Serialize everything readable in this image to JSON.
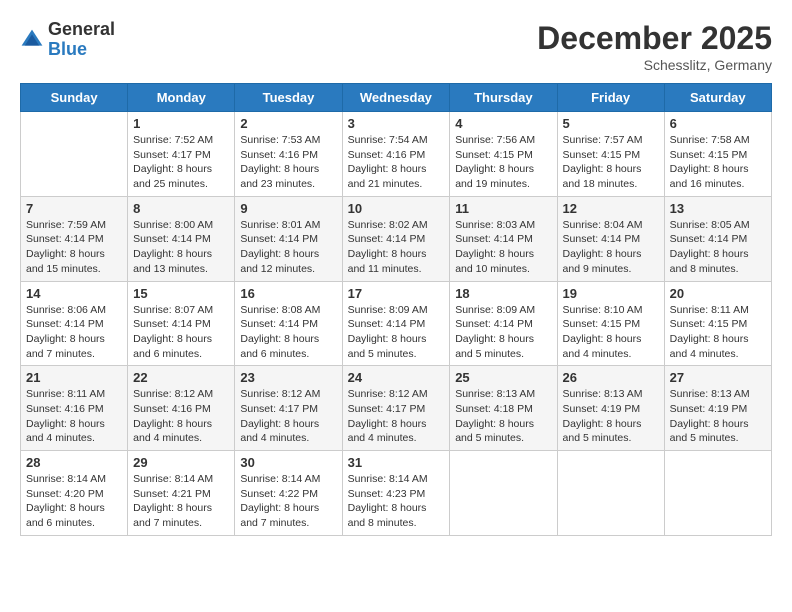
{
  "header": {
    "logo_general": "General",
    "logo_blue": "Blue",
    "month_title": "December 2025",
    "location": "Schesslitz, Germany"
  },
  "days_of_week": [
    "Sunday",
    "Monday",
    "Tuesday",
    "Wednesday",
    "Thursday",
    "Friday",
    "Saturday"
  ],
  "weeks": [
    [
      {
        "day": "",
        "content": ""
      },
      {
        "day": "1",
        "content": "Sunrise: 7:52 AM\nSunset: 4:17 PM\nDaylight: 8 hours\nand 25 minutes."
      },
      {
        "day": "2",
        "content": "Sunrise: 7:53 AM\nSunset: 4:16 PM\nDaylight: 8 hours\nand 23 minutes."
      },
      {
        "day": "3",
        "content": "Sunrise: 7:54 AM\nSunset: 4:16 PM\nDaylight: 8 hours\nand 21 minutes."
      },
      {
        "day": "4",
        "content": "Sunrise: 7:56 AM\nSunset: 4:15 PM\nDaylight: 8 hours\nand 19 minutes."
      },
      {
        "day": "5",
        "content": "Sunrise: 7:57 AM\nSunset: 4:15 PM\nDaylight: 8 hours\nand 18 minutes."
      },
      {
        "day": "6",
        "content": "Sunrise: 7:58 AM\nSunset: 4:15 PM\nDaylight: 8 hours\nand 16 minutes."
      }
    ],
    [
      {
        "day": "7",
        "content": "Sunrise: 7:59 AM\nSunset: 4:14 PM\nDaylight: 8 hours\nand 15 minutes."
      },
      {
        "day": "8",
        "content": "Sunrise: 8:00 AM\nSunset: 4:14 PM\nDaylight: 8 hours\nand 13 minutes."
      },
      {
        "day": "9",
        "content": "Sunrise: 8:01 AM\nSunset: 4:14 PM\nDaylight: 8 hours\nand 12 minutes."
      },
      {
        "day": "10",
        "content": "Sunrise: 8:02 AM\nSunset: 4:14 PM\nDaylight: 8 hours\nand 11 minutes."
      },
      {
        "day": "11",
        "content": "Sunrise: 8:03 AM\nSunset: 4:14 PM\nDaylight: 8 hours\nand 10 minutes."
      },
      {
        "day": "12",
        "content": "Sunrise: 8:04 AM\nSunset: 4:14 PM\nDaylight: 8 hours\nand 9 minutes."
      },
      {
        "day": "13",
        "content": "Sunrise: 8:05 AM\nSunset: 4:14 PM\nDaylight: 8 hours\nand 8 minutes."
      }
    ],
    [
      {
        "day": "14",
        "content": "Sunrise: 8:06 AM\nSunset: 4:14 PM\nDaylight: 8 hours\nand 7 minutes."
      },
      {
        "day": "15",
        "content": "Sunrise: 8:07 AM\nSunset: 4:14 PM\nDaylight: 8 hours\nand 6 minutes."
      },
      {
        "day": "16",
        "content": "Sunrise: 8:08 AM\nSunset: 4:14 PM\nDaylight: 8 hours\nand 6 minutes."
      },
      {
        "day": "17",
        "content": "Sunrise: 8:09 AM\nSunset: 4:14 PM\nDaylight: 8 hours\nand 5 minutes."
      },
      {
        "day": "18",
        "content": "Sunrise: 8:09 AM\nSunset: 4:14 PM\nDaylight: 8 hours\nand 5 minutes."
      },
      {
        "day": "19",
        "content": "Sunrise: 8:10 AM\nSunset: 4:15 PM\nDaylight: 8 hours\nand 4 minutes."
      },
      {
        "day": "20",
        "content": "Sunrise: 8:11 AM\nSunset: 4:15 PM\nDaylight: 8 hours\nand 4 minutes."
      }
    ],
    [
      {
        "day": "21",
        "content": "Sunrise: 8:11 AM\nSunset: 4:16 PM\nDaylight: 8 hours\nand 4 minutes."
      },
      {
        "day": "22",
        "content": "Sunrise: 8:12 AM\nSunset: 4:16 PM\nDaylight: 8 hours\nand 4 minutes."
      },
      {
        "day": "23",
        "content": "Sunrise: 8:12 AM\nSunset: 4:17 PM\nDaylight: 8 hours\nand 4 minutes."
      },
      {
        "day": "24",
        "content": "Sunrise: 8:12 AM\nSunset: 4:17 PM\nDaylight: 8 hours\nand 4 minutes."
      },
      {
        "day": "25",
        "content": "Sunrise: 8:13 AM\nSunset: 4:18 PM\nDaylight: 8 hours\nand 5 minutes."
      },
      {
        "day": "26",
        "content": "Sunrise: 8:13 AM\nSunset: 4:19 PM\nDaylight: 8 hours\nand 5 minutes."
      },
      {
        "day": "27",
        "content": "Sunrise: 8:13 AM\nSunset: 4:19 PM\nDaylight: 8 hours\nand 5 minutes."
      }
    ],
    [
      {
        "day": "28",
        "content": "Sunrise: 8:14 AM\nSunset: 4:20 PM\nDaylight: 8 hours\nand 6 minutes."
      },
      {
        "day": "29",
        "content": "Sunrise: 8:14 AM\nSunset: 4:21 PM\nDaylight: 8 hours\nand 7 minutes."
      },
      {
        "day": "30",
        "content": "Sunrise: 8:14 AM\nSunset: 4:22 PM\nDaylight: 8 hours\nand 7 minutes."
      },
      {
        "day": "31",
        "content": "Sunrise: 8:14 AM\nSunset: 4:23 PM\nDaylight: 8 hours\nand 8 minutes."
      },
      {
        "day": "",
        "content": ""
      },
      {
        "day": "",
        "content": ""
      },
      {
        "day": "",
        "content": ""
      }
    ]
  ]
}
